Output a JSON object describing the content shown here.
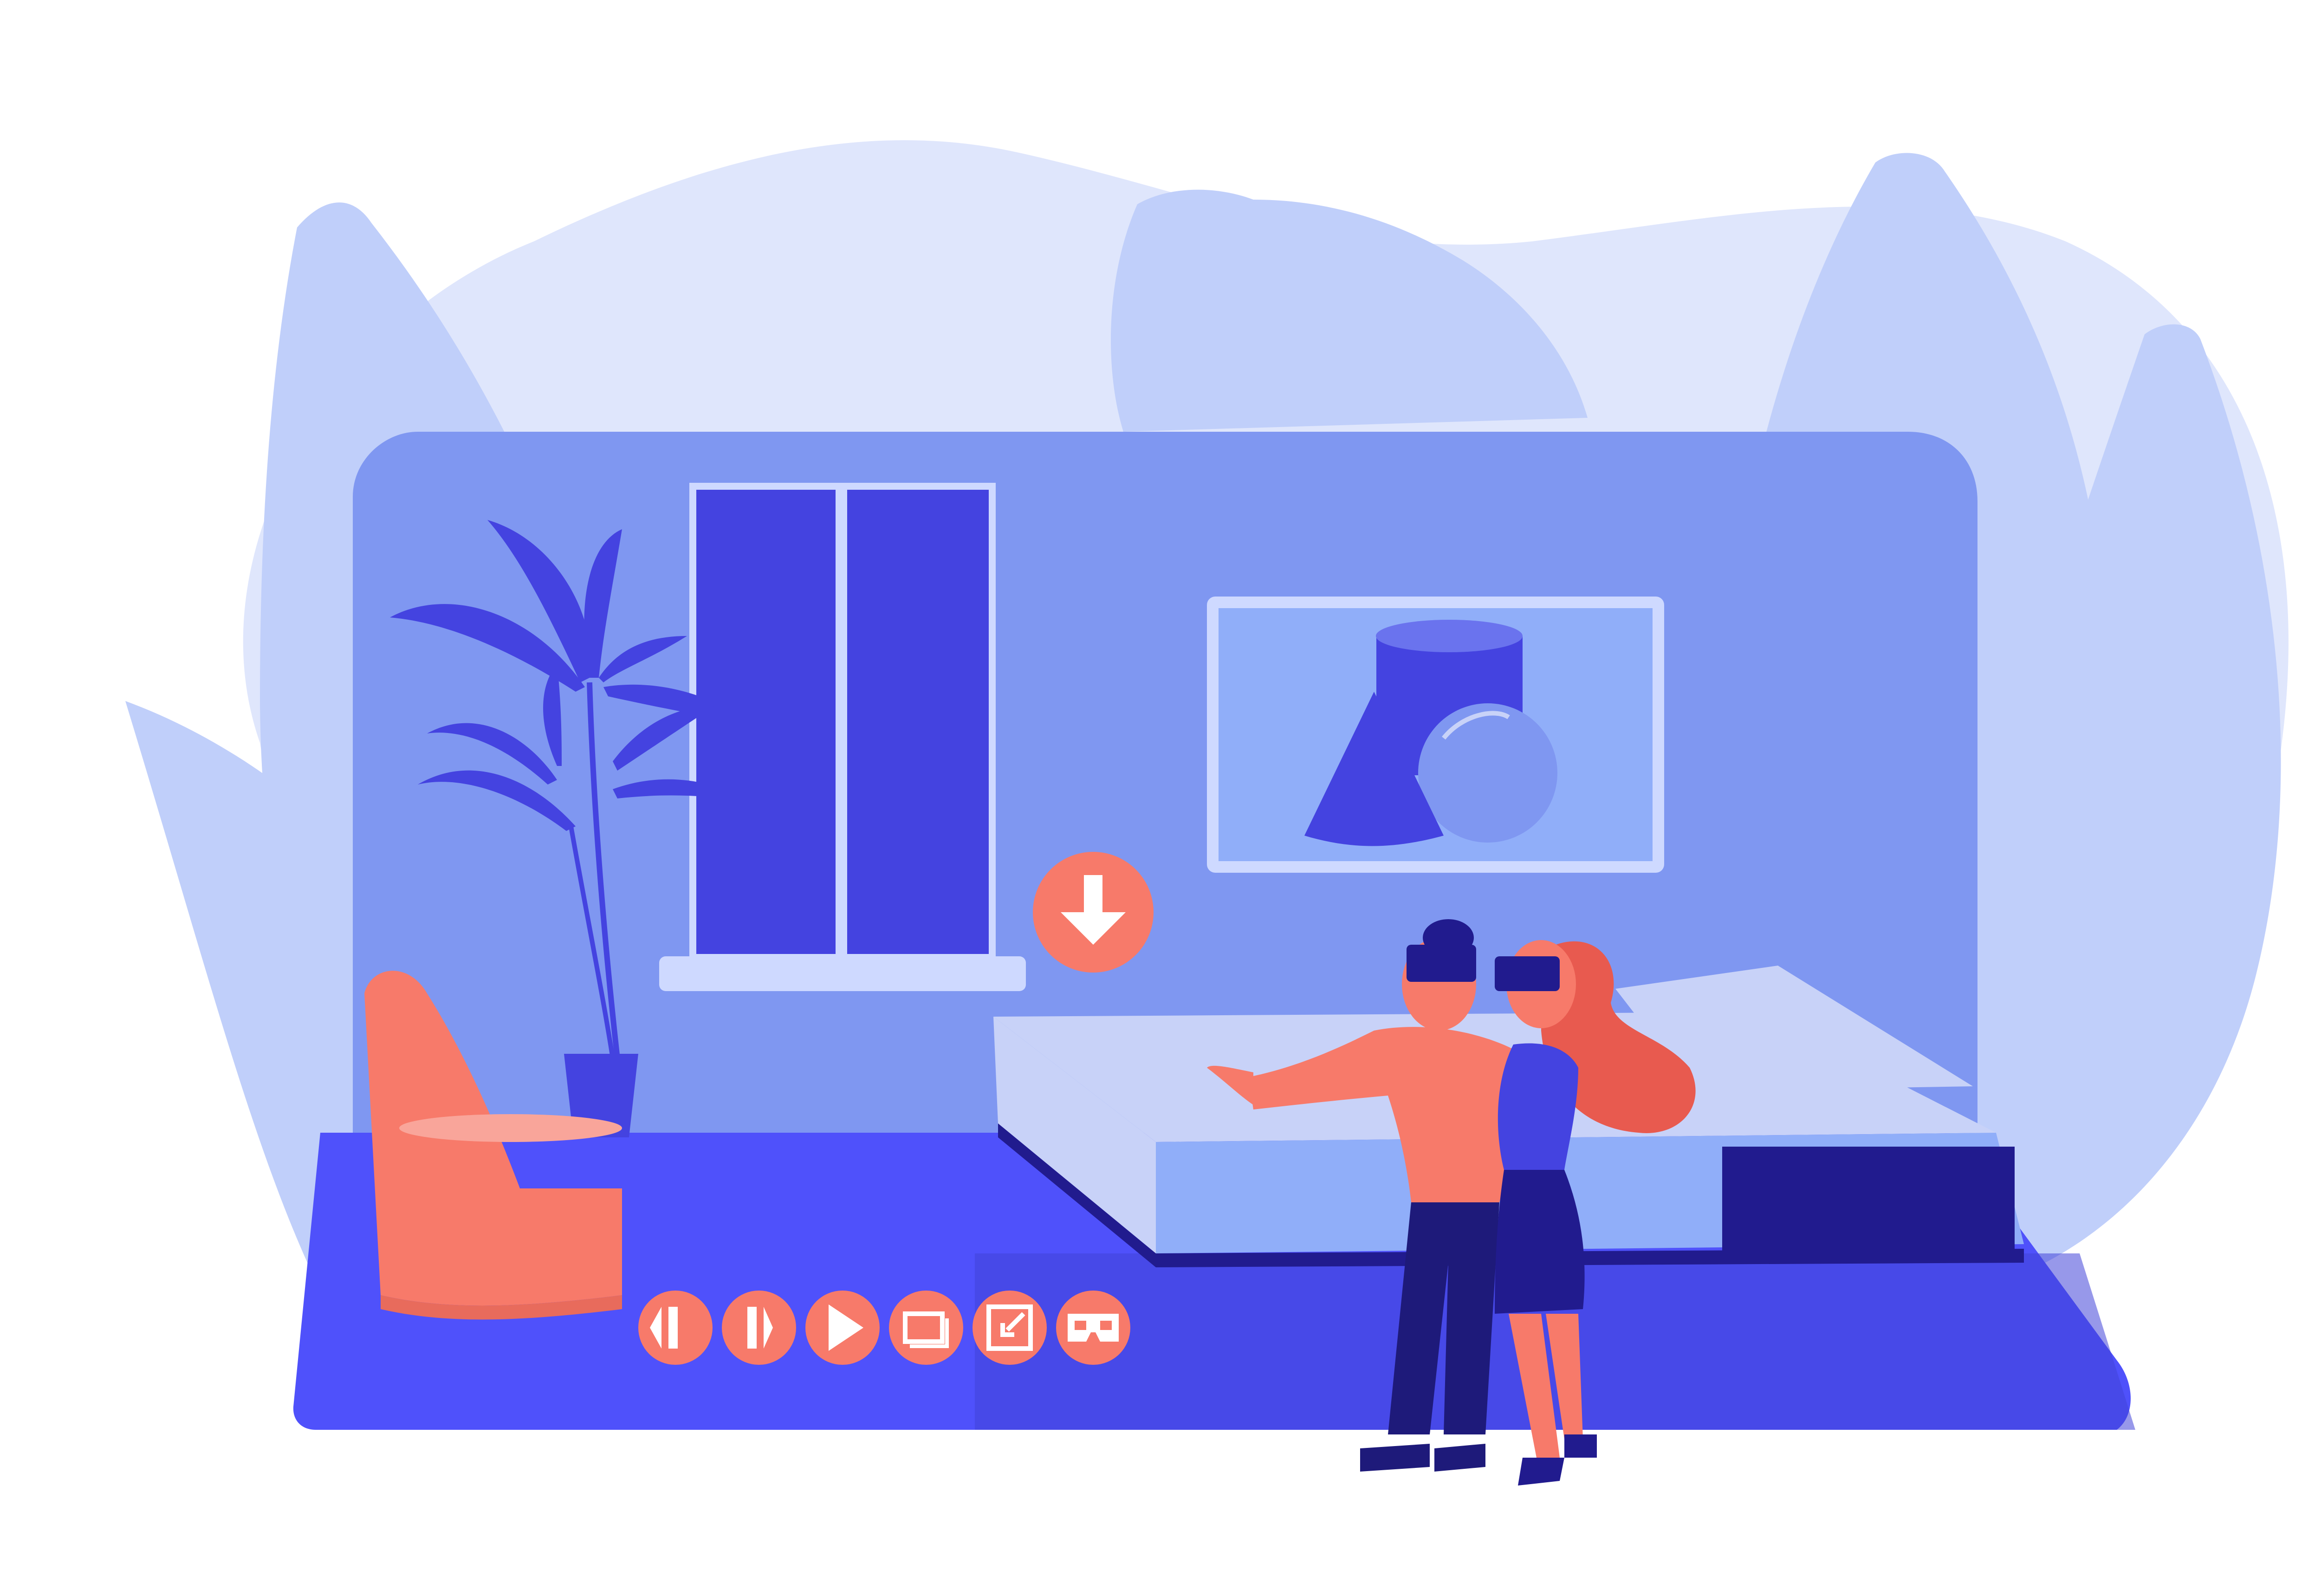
{
  "colors": {
    "background": "#ffffff",
    "blob_light": "#dfe6fc",
    "leaf_light": "#c0cffa",
    "wall": "#7f97f1",
    "floor": "#4f51fb",
    "floor_shadow": "#4143d8",
    "window_frame": "#ced9ff",
    "window_glass": "#4443e0",
    "accent_coral": "#f77a6a",
    "accent_coral_dark": "#e85a4f",
    "bed_top": "#c8d2f8",
    "bed_side": "#90aef9",
    "bed_base": "#211b8e",
    "navy": "#1e1a7a",
    "icon_white": "#ffffff"
  },
  "icons": {
    "download": "arrow-down-icon",
    "rewind": "rewind-icon",
    "pause": "pause-icon",
    "play": "play-icon",
    "screens": "screens-icon",
    "exit_fullscreen": "exit-fullscreen-icon",
    "vr": "vr-headset-icon"
  },
  "controls": [
    "rewind",
    "pause",
    "play",
    "screens",
    "exit_fullscreen",
    "vr"
  ]
}
